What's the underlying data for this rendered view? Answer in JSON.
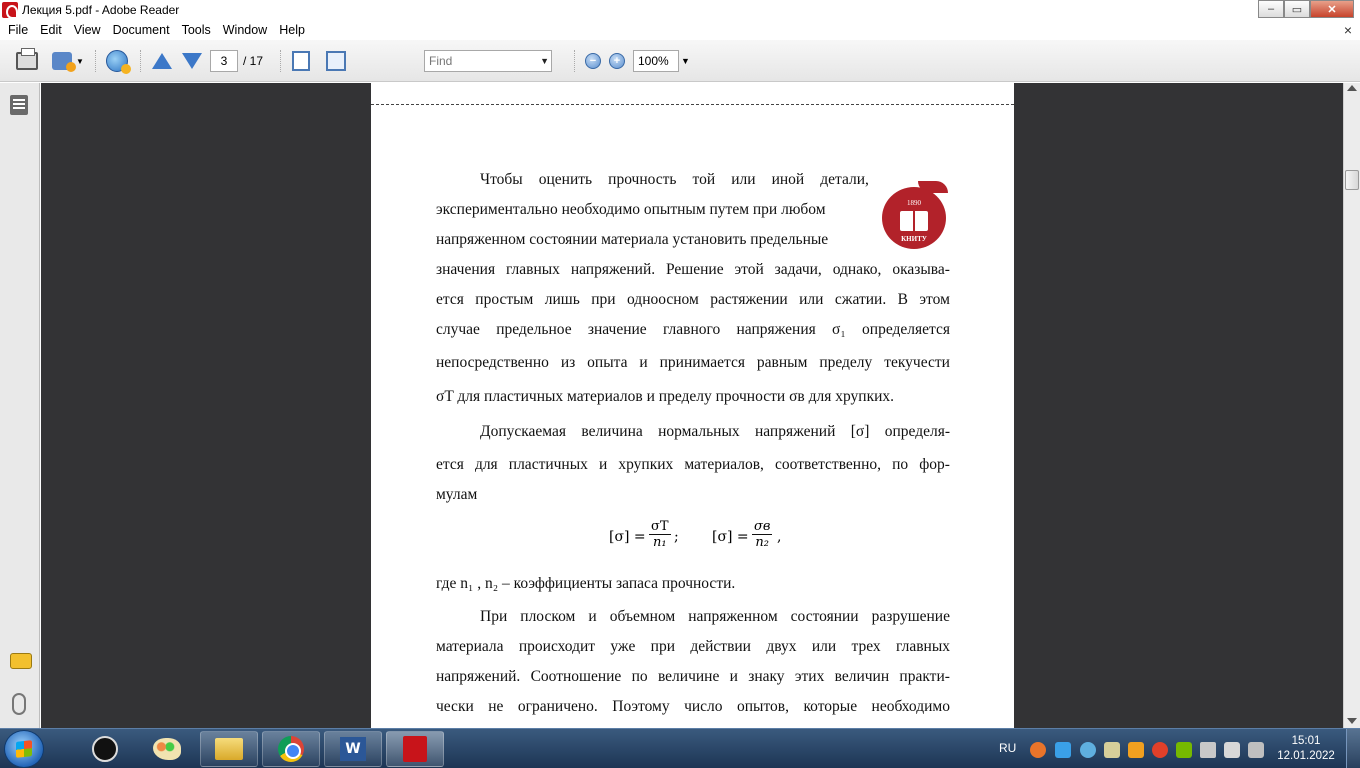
{
  "window": {
    "title": "Лекция 5.pdf - Adobe Reader",
    "controls": {
      "minimize": "–",
      "maximize": "▭",
      "close": "✕"
    }
  },
  "menu": {
    "items": [
      "File",
      "Edit",
      "View",
      "Document",
      "Tools",
      "Window",
      "Help"
    ],
    "close_glyph": "×"
  },
  "toolbar": {
    "current_page": "3",
    "page_total": "/ 17",
    "find_placeholder": "Find",
    "zoom_value": "100%",
    "zoom_out_glyph": "−",
    "zoom_in_glyph": "+",
    "dropdown_glyph": "▼"
  },
  "document": {
    "logo": {
      "year": "1890",
      "name": "КНИТУ"
    },
    "p1_lines": [
      [
        "Чтобы",
        "оценить",
        "прочность",
        "той",
        "или",
        "иной",
        "детали,"
      ],
      [
        "экспериментально необходимо опытным путем при любом"
      ],
      [
        "напряженном состоянии материала установить предельные"
      ],
      [
        "значения",
        "главных",
        "напряжений.",
        "Решение",
        "этой",
        "задачи,",
        "однако,",
        "оказыва-"
      ],
      [
        "ется",
        "простым",
        "лишь",
        "при",
        "одноосном",
        "растяжении",
        "или",
        "сжатии.",
        "В",
        "этом"
      ],
      [
        "случае",
        "предельное",
        "значение",
        "главного",
        "напряжения",
        "σ₁",
        "определяется"
      ],
      [
        "непосредственно",
        "из",
        "опыта",
        "и",
        "принимается",
        "равным",
        "пределу",
        "текучести"
      ],
      [
        "σT  для пластичных материалов и пределу прочности  σв  для хрупких."
      ]
    ],
    "p2_lines": [
      [
        "Допускаемая",
        "величина",
        "нормальных",
        "напряжений",
        "[σ]",
        "определя-"
      ],
      [
        "ется",
        "для",
        "пластичных",
        "и",
        "хрупких",
        "материалов,",
        "соответственно,",
        "по",
        "фор-"
      ],
      [
        "мулам"
      ]
    ],
    "formula": {
      "lhs": "[σ] =",
      "num1": "σT",
      "den1": "n₁",
      "sep1": ";",
      "num2": "σв",
      "den2": "n₂",
      "sep2": ","
    },
    "where_line": "где  n₁ , n₂  – коэффициенты запаса прочности.",
    "p3_lines": [
      [
        "При",
        "плоском",
        "и",
        "объемном",
        "напряженном",
        "состоянии",
        "разрушение"
      ],
      [
        "материала",
        "происходит",
        "уже",
        "при",
        "действии",
        "двух",
        "или",
        "трех",
        "главных"
      ],
      [
        "напряжений.",
        "Соотношение",
        "по",
        "величине",
        "и",
        "знаку",
        "этих",
        "величин",
        "практи-"
      ],
      [
        "чески",
        "не",
        "ограничено.",
        "Поэтому",
        "число",
        "опытов,",
        "которые",
        "необходимо"
      ]
    ]
  },
  "taskbar": {
    "language": "RU",
    "time": "15:01",
    "date": "12.01.2022",
    "word_label": "W",
    "apps": [
      "steam",
      "paint",
      "explorer",
      "chrome",
      "word",
      "acrobat"
    ]
  },
  "colors": {
    "doc_background": "#333335",
    "logo_red": "#b2222a",
    "taskbar": "#1d3554"
  }
}
